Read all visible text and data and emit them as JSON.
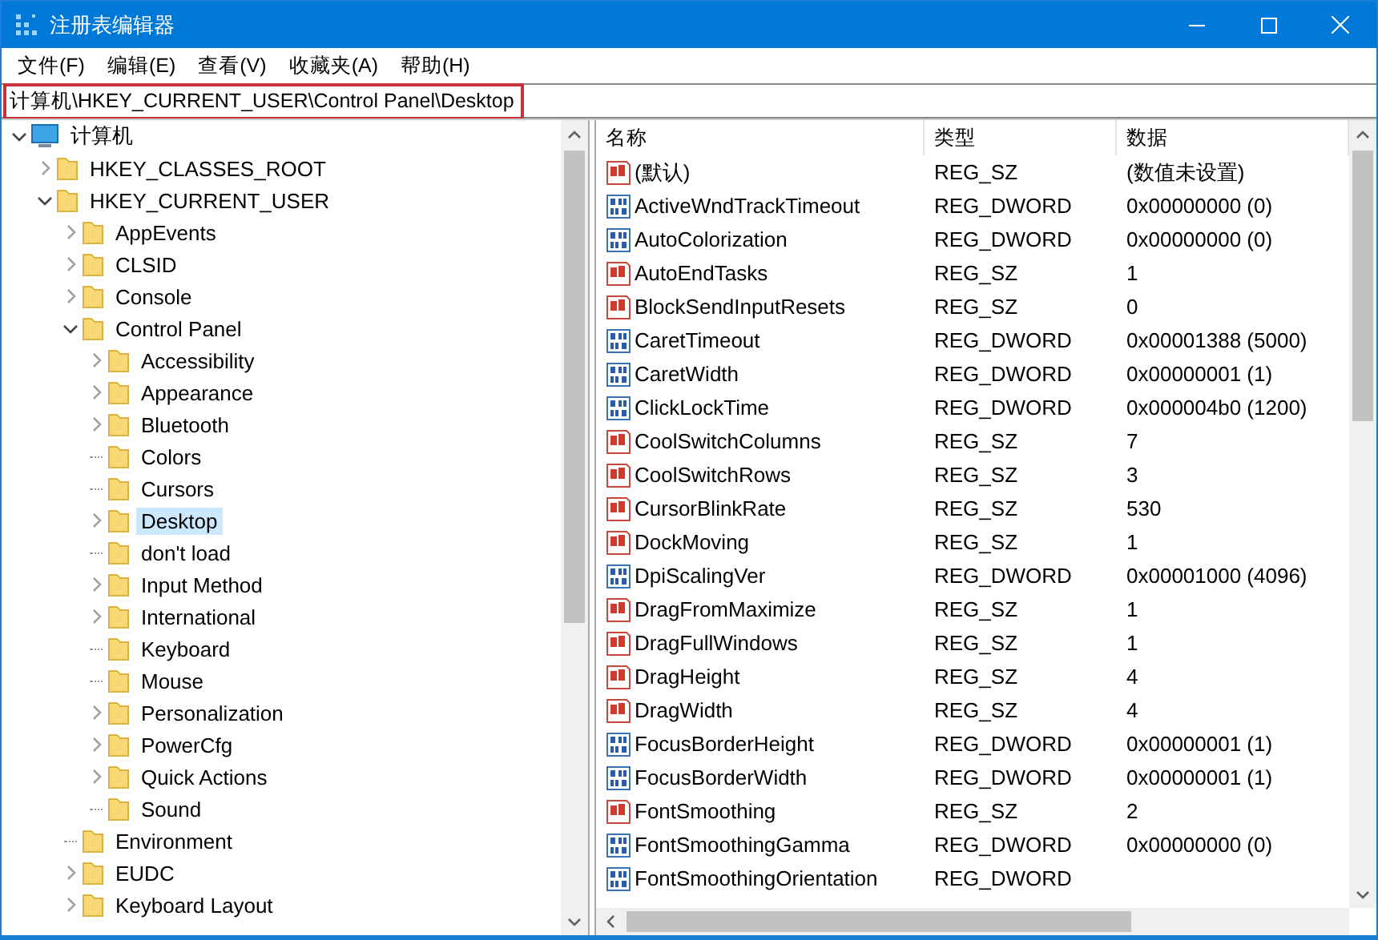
{
  "window": {
    "title": "注册表编辑器"
  },
  "menu": [
    "文件(F)",
    "编辑(E)",
    "查看(V)",
    "收藏夹(A)",
    "帮助(H)"
  ],
  "address": {
    "value": "计算机\\HKEY_CURRENT_USER\\Control Panel\\Desktop",
    "highlighted": true
  },
  "tree": [
    {
      "label": "计算机",
      "kind": "computer",
      "expanded": true,
      "selected": false,
      "children": [
        {
          "label": "HKEY_CLASSES_ROOT",
          "kind": "folder",
          "expanded": false,
          "selected": false
        },
        {
          "label": "HKEY_CURRENT_USER",
          "kind": "folder",
          "expanded": true,
          "selected": false,
          "children": [
            {
              "label": "AppEvents",
              "kind": "folder",
              "expanded": false,
              "selected": false
            },
            {
              "label": "CLSID",
              "kind": "folder",
              "expanded": false,
              "selected": false
            },
            {
              "label": "Console",
              "kind": "folder",
              "expanded": false,
              "selected": false
            },
            {
              "label": "Control Panel",
              "kind": "folder",
              "expanded": true,
              "selected": false,
              "children": [
                {
                  "label": "Accessibility",
                  "kind": "folder",
                  "expanded": false,
                  "selected": false
                },
                {
                  "label": "Appearance",
                  "kind": "folder",
                  "expanded": false,
                  "selected": false
                },
                {
                  "label": "Bluetooth",
                  "kind": "folder",
                  "expanded": false,
                  "selected": false
                },
                {
                  "label": "Colors",
                  "kind": "folder",
                  "selected": false
                },
                {
                  "label": "Cursors",
                  "kind": "folder",
                  "selected": false
                },
                {
                  "label": "Desktop",
                  "kind": "folder",
                  "expanded": false,
                  "selected": true
                },
                {
                  "label": "don't load",
                  "kind": "folder",
                  "selected": false
                },
                {
                  "label": "Input Method",
                  "kind": "folder",
                  "expanded": false,
                  "selected": false
                },
                {
                  "label": "International",
                  "kind": "folder",
                  "expanded": false,
                  "selected": false
                },
                {
                  "label": "Keyboard",
                  "kind": "folder",
                  "selected": false
                },
                {
                  "label": "Mouse",
                  "kind": "folder",
                  "selected": false
                },
                {
                  "label": "Personalization",
                  "kind": "folder",
                  "expanded": false,
                  "selected": false
                },
                {
                  "label": "PowerCfg",
                  "kind": "folder",
                  "expanded": false,
                  "selected": false
                },
                {
                  "label": "Quick Actions",
                  "kind": "folder",
                  "expanded": false,
                  "selected": false
                },
                {
                  "label": "Sound",
                  "kind": "folder",
                  "selected": false
                }
              ]
            },
            {
              "label": "Environment",
              "kind": "folder",
              "selected": false
            },
            {
              "label": "EUDC",
              "kind": "folder",
              "expanded": false,
              "selected": false
            },
            {
              "label": "Keyboard Layout",
              "kind": "folder",
              "expanded": false,
              "selected": false
            }
          ]
        }
      ]
    }
  ],
  "table": {
    "columns": [
      "名称",
      "类型",
      "数据"
    ],
    "rows": [
      {
        "kind": "sz",
        "name": "(默认)",
        "type": "REG_SZ",
        "data": "(数值未设置)"
      },
      {
        "kind": "dword",
        "name": "ActiveWndTrackTimeout",
        "type": "REG_DWORD",
        "data": "0x00000000 (0)"
      },
      {
        "kind": "dword",
        "name": "AutoColorization",
        "type": "REG_DWORD",
        "data": "0x00000000 (0)"
      },
      {
        "kind": "sz",
        "name": "AutoEndTasks",
        "type": "REG_SZ",
        "data": "1"
      },
      {
        "kind": "sz",
        "name": "BlockSendInputResets",
        "type": "REG_SZ",
        "data": "0"
      },
      {
        "kind": "dword",
        "name": "CaretTimeout",
        "type": "REG_DWORD",
        "data": "0x00001388 (5000)"
      },
      {
        "kind": "dword",
        "name": "CaretWidth",
        "type": "REG_DWORD",
        "data": "0x00000001 (1)"
      },
      {
        "kind": "dword",
        "name": "ClickLockTime",
        "type": "REG_DWORD",
        "data": "0x000004b0 (1200)"
      },
      {
        "kind": "sz",
        "name": "CoolSwitchColumns",
        "type": "REG_SZ",
        "data": "7"
      },
      {
        "kind": "sz",
        "name": "CoolSwitchRows",
        "type": "REG_SZ",
        "data": "3"
      },
      {
        "kind": "sz",
        "name": "CursorBlinkRate",
        "type": "REG_SZ",
        "data": "530"
      },
      {
        "kind": "sz",
        "name": "DockMoving",
        "type": "REG_SZ",
        "data": "1"
      },
      {
        "kind": "dword",
        "name": "DpiScalingVer",
        "type": "REG_DWORD",
        "data": "0x00001000 (4096)"
      },
      {
        "kind": "sz",
        "name": "DragFromMaximize",
        "type": "REG_SZ",
        "data": "1"
      },
      {
        "kind": "sz",
        "name": "DragFullWindows",
        "type": "REG_SZ",
        "data": "1"
      },
      {
        "kind": "sz",
        "name": "DragHeight",
        "type": "REG_SZ",
        "data": "4"
      },
      {
        "kind": "sz",
        "name": "DragWidth",
        "type": "REG_SZ",
        "data": "4"
      },
      {
        "kind": "dword",
        "name": "FocusBorderHeight",
        "type": "REG_DWORD",
        "data": "0x00000001 (1)"
      },
      {
        "kind": "dword",
        "name": "FocusBorderWidth",
        "type": "REG_DWORD",
        "data": "0x00000001 (1)"
      },
      {
        "kind": "sz",
        "name": "FontSmoothing",
        "type": "REG_SZ",
        "data": "2"
      },
      {
        "kind": "dword",
        "name": "FontSmoothingGamma",
        "type": "REG_DWORD",
        "data": "0x00000000 (0)"
      },
      {
        "kind": "dword",
        "name": "FontSmoothingOrientation",
        "type": "REG_DWORD"
      }
    ]
  }
}
